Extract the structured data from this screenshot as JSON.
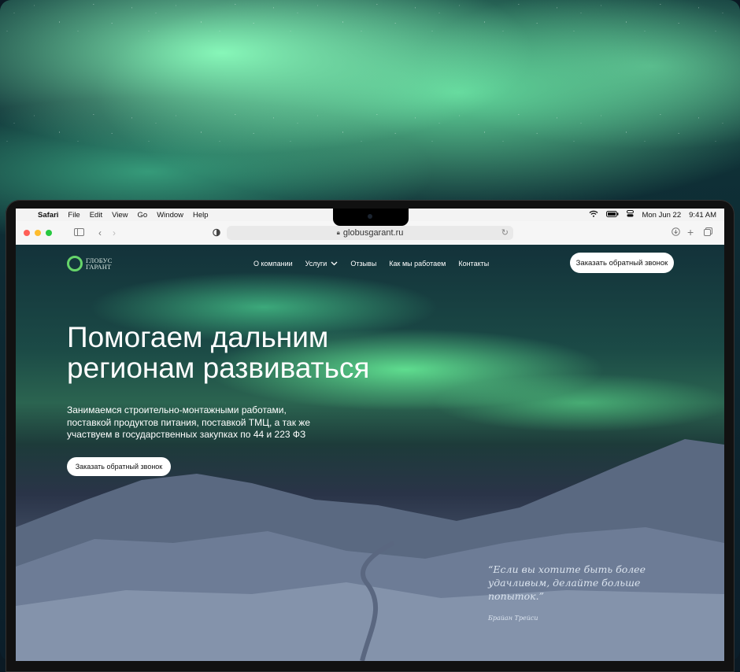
{
  "menubar": {
    "apple": "",
    "app": "Safari",
    "items": [
      "File",
      "Edit",
      "View",
      "Go",
      "Window",
      "Help"
    ],
    "date": "Mon Jun 22",
    "time": "9:41 AM"
  },
  "browser": {
    "url": "globusgarant.ru"
  },
  "site": {
    "logo_line1": "ГЛОБУС",
    "logo_line2": "ГАРАНТ",
    "nav": [
      "О компании",
      "Услуги",
      "Отзывы",
      "Как мы работаем",
      "Контакты"
    ],
    "nav_cta": "Заказать обратный звонок",
    "hero_title_line1": "Помогаем дальним",
    "hero_title_line2": "регионам развиваться",
    "hero_sub_line1": "Занимаемся строительно-монтажными работами,",
    "hero_sub_line2": "поставкой продуктов питания, поставкой ТМЦ, а так же",
    "hero_sub_line3": "участвуем в государственных закупках по 44 и 223 ФЗ",
    "hero_cta": "Заказать обратный звонок",
    "quote_line1": "“Если вы хотите быть более",
    "quote_line2": "удачливым, делайте больше",
    "quote_line3": "попыток.”",
    "quote_author": "Брайан Трейси"
  },
  "colors": {
    "accent_logo": "#66d46a",
    "traffic_red": "#ff5f57",
    "traffic_yellow": "#febc2e",
    "traffic_green": "#28c840"
  }
}
